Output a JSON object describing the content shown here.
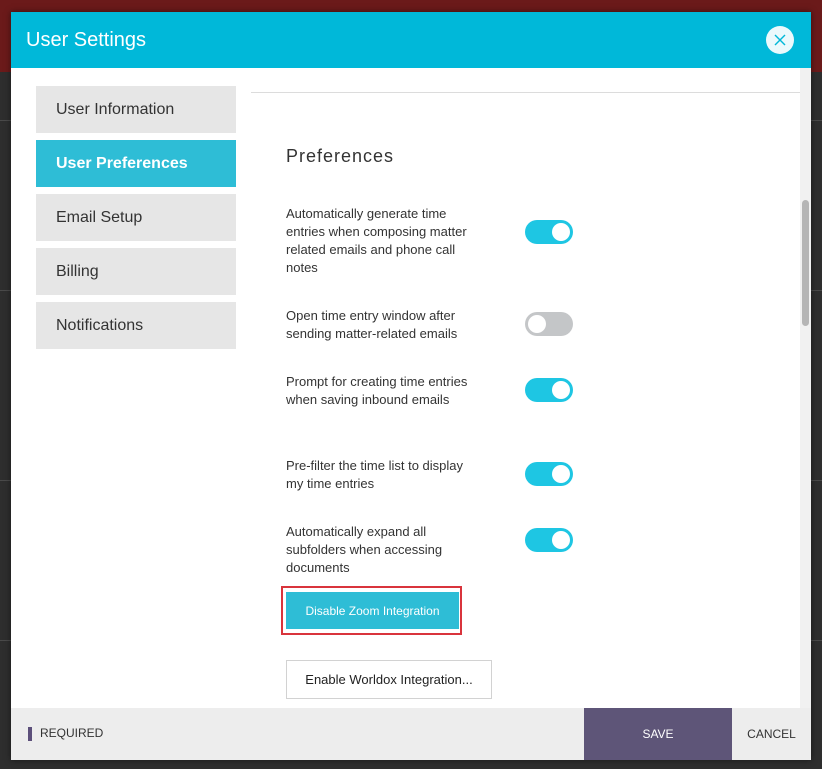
{
  "modal": {
    "title": "User Settings"
  },
  "sidebar": {
    "items": [
      {
        "label": "User Information"
      },
      {
        "label": "User Preferences"
      },
      {
        "label": "Email Setup"
      },
      {
        "label": "Billing"
      },
      {
        "label": "Notifications"
      }
    ],
    "active_item": "User Preferences"
  },
  "preferences": {
    "title": "Preferences",
    "items": [
      {
        "label": "Automatically generate time entries when composing matter related emails and phone call notes",
        "enabled": true
      },
      {
        "label": "Open time entry window after sending matter-related emails",
        "enabled": false
      },
      {
        "label": "Prompt for creating time entries when saving inbound emails",
        "enabled": true
      },
      {
        "label": "Pre-filter the time list to display my time entries",
        "enabled": true
      },
      {
        "label": "Automatically expand all subfolders when accessing documents",
        "enabled": true
      }
    ]
  },
  "buttons": {
    "zoom": "Disable Zoom Integration",
    "worldox": "Enable Worldox Integration..."
  },
  "footer": {
    "required": "REQUIRED",
    "save": "SAVE",
    "cancel": "CANCEL"
  },
  "colors": {
    "header": "#00b8d9",
    "active_tab": "#2ebdd6",
    "toggle_on": "#1ec6e3",
    "toggle_off": "#c4c6c8",
    "save_button": "#5e5578",
    "highlight": "#d9343c"
  },
  "icons": {
    "close": "close-icon"
  }
}
